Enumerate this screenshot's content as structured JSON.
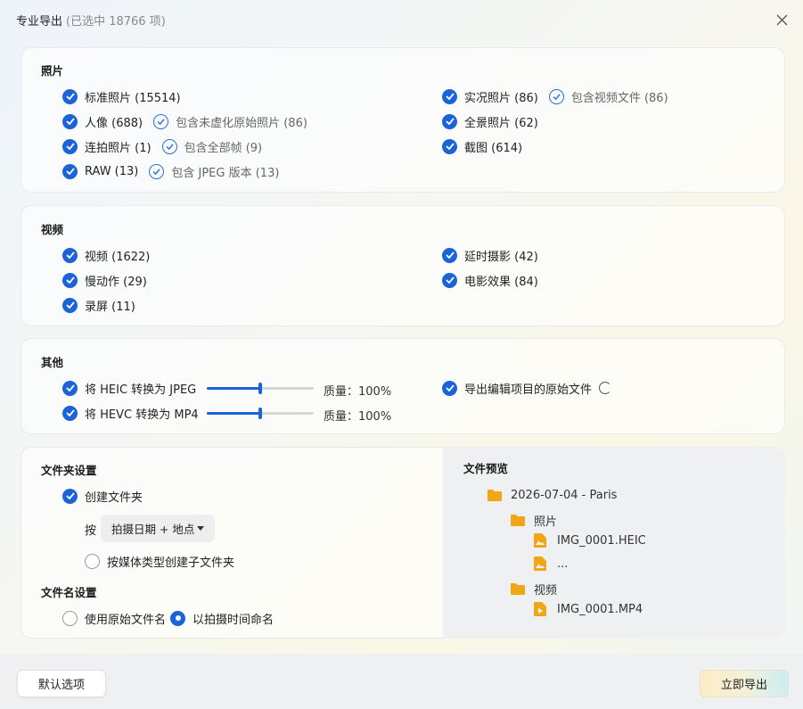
{
  "dialog": {
    "title": "专业导出",
    "selection": "(已选中 18766 项)"
  },
  "photos": {
    "title": "照片",
    "standard": "标准照片 (15514)",
    "portrait": "人像 (688)",
    "portrait_sub": "包含未虚化原始照片 (86)",
    "burst": "连拍照片 (1)",
    "burst_sub": "包含全部帧 (9)",
    "raw": "RAW (13)",
    "raw_sub": "包含 JPEG 版本 (13)",
    "live": "实况照片 (86)",
    "live_sub": "包含视频文件 (86)",
    "panorama": "全景照片 (62)",
    "screenshot": "截图 (614)"
  },
  "videos": {
    "title": "视频",
    "video": "视频 (1622)",
    "slowmo": "慢动作 (29)",
    "screenrec": "录屏 (11)",
    "timelapse": "延时摄影 (42)",
    "cinematic": "电影效果 (84)"
  },
  "other": {
    "title": "其他",
    "heic": "将 HEIC 转换为 JPEG",
    "heic_quality": "质量：100%",
    "heic_level": 0.5,
    "hevc": "将 HEVC 转换为 MP4",
    "hevc_quality": "质量：100%",
    "hevc_level": 0.5,
    "originals": "导出编辑项目的原始文件"
  },
  "folder": {
    "title": "文件夹设置",
    "create": "创建文件夹",
    "by": "按",
    "by_value": "拍摄日期 + 地点",
    "by_media": "按媒体类型创建子文件夹"
  },
  "filename": {
    "title": "文件名设置",
    "original": "使用原始文件名",
    "by_time": "以拍摄时间命名"
  },
  "preview": {
    "title": "文件预览",
    "root": "2026-07-04 - Paris",
    "photos_folder": "照片",
    "file1": "IMG_0001.HEIC",
    "file2": "...",
    "videos_folder": "视频",
    "file3": "IMG_0001.MP4"
  },
  "buttons": {
    "default": "默认选项",
    "export": "立即导出"
  },
  "colors": {
    "accent": "#1a63d8",
    "folder": "#f2a516"
  }
}
